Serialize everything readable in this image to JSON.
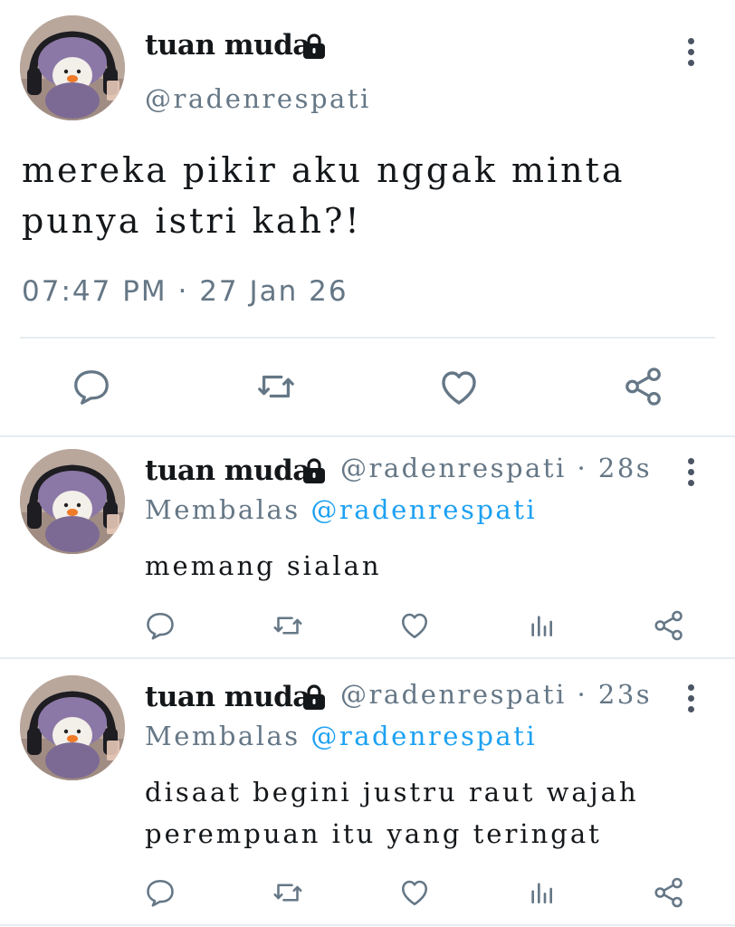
{
  "tweet": {
    "display_name": "tuan muda",
    "handle": "@radenrespati",
    "text": "mereka pikir aku nggak minta punya istri kah?!",
    "timestamp": "07:47 PM · 27 Jan 26"
  },
  "replies": [
    {
      "display_name": "tuan muda",
      "handle": "@radenrespati",
      "time": "· 28s",
      "replying_prefix": "Membalas",
      "replying_to": "@radenrespati",
      "text": "memang sialan"
    },
    {
      "display_name": "tuan muda",
      "handle": "@radenrespati",
      "time": "· 23s",
      "replying_prefix": "Membalas",
      "replying_to": "@radenrespati",
      "text_line1": "disaat begini  justru raut wajah",
      "text_line2": "perempuan itu yang teringat"
    }
  ],
  "icons": {
    "verified_badge": "lock-icon",
    "menu": "more-vertical-icon",
    "actions": [
      "reply-icon",
      "retweet-icon",
      "like-icon",
      "analytics-icon",
      "share-icon"
    ]
  },
  "colors": {
    "text": "#14171a",
    "muted": "#657786",
    "link": "#1da1f2",
    "divider": "#e6ecf0"
  }
}
